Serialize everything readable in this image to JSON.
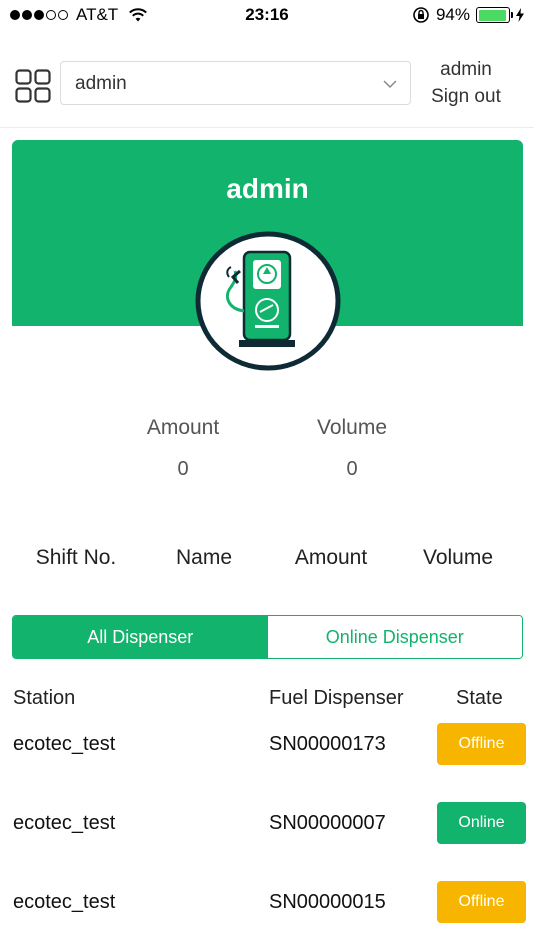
{
  "status_bar": {
    "carrier": "AT&T",
    "time": "23:16",
    "battery": "94%",
    "battery_level": 0.94,
    "signal_dots_filled": 3,
    "signal_dots_total": 5
  },
  "header": {
    "select_value": "admin",
    "user_name": "admin",
    "sign_out": "Sign out"
  },
  "hero": {
    "title": "admin"
  },
  "stats": {
    "amount_label": "Amount",
    "amount_value": "0",
    "volume_label": "Volume",
    "volume_value": "0"
  },
  "shift_columns": [
    "Shift No.",
    "Name",
    "Amount",
    "Volume"
  ],
  "tabs": [
    {
      "label": "All Dispenser",
      "active": true
    },
    {
      "label": "Online Dispenser",
      "active": false
    }
  ],
  "table": {
    "headers": [
      "Station",
      "Fuel Dispenser",
      "State"
    ],
    "rows": [
      {
        "station": "ecotec_test",
        "dispenser": "SN00000173",
        "state": "Offline"
      },
      {
        "station": "ecotec_test",
        "dispenser": "SN00000007",
        "state": "Online"
      },
      {
        "station": "ecotec_test",
        "dispenser": "SN00000015",
        "state": "Offline"
      }
    ]
  },
  "colors": {
    "brand": "#12b36c",
    "offline": "#f7b500",
    "online": "#12b36c"
  },
  "icons": {
    "menu": "grid-icon",
    "dropdown": "chevron-down-icon",
    "avatar": "fuel-dispenser-icon"
  }
}
